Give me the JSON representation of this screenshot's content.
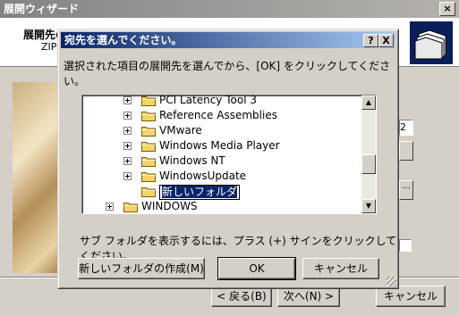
{
  "wizard": {
    "title": "展開ウィザード",
    "header_title": "展開先の",
    "header_subtitle": "ZIP",
    "side_field_text": "2",
    "side_button_label": "...",
    "back_button": "< 戻る(B)",
    "next_button": "次へ(N) >",
    "cancel_button": "キャンセル",
    "colors": {
      "title_bar": "#848284",
      "logo_bg": "#0a1e5c"
    }
  },
  "dialog": {
    "title": "宛先を選んでください。",
    "help_button": "?",
    "close_button": "X",
    "message": "選択された項目の展開先を選んでから、[OK] をクリックしてください。",
    "tree_items": [
      {
        "label": "PCI Latency Tool 3",
        "expandable": true,
        "indent": 2
      },
      {
        "label": "Reference Assemblies",
        "expandable": true,
        "indent": 2
      },
      {
        "label": "VMware",
        "expandable": true,
        "indent": 2
      },
      {
        "label": "Windows Media Player",
        "expandable": true,
        "indent": 2
      },
      {
        "label": "Windows NT",
        "expandable": true,
        "indent": 2
      },
      {
        "label": "WindowsUpdate",
        "expandable": true,
        "indent": 2
      },
      {
        "label": "新しいフォルダ",
        "expandable": false,
        "indent": 2,
        "editing": true
      },
      {
        "label": "WINDOWS",
        "expandable": true,
        "indent": 1
      }
    ],
    "hint": "サブ フォルダを表示するには、プラス (+) サインをクリックしてください。",
    "new_folder_button": "新しいフォルダの作成(M)",
    "ok_button": "OK",
    "cancel_button": "キャンセル",
    "colors": {
      "title_bar": "#0a246a",
      "folder": "#f4d36a"
    }
  }
}
